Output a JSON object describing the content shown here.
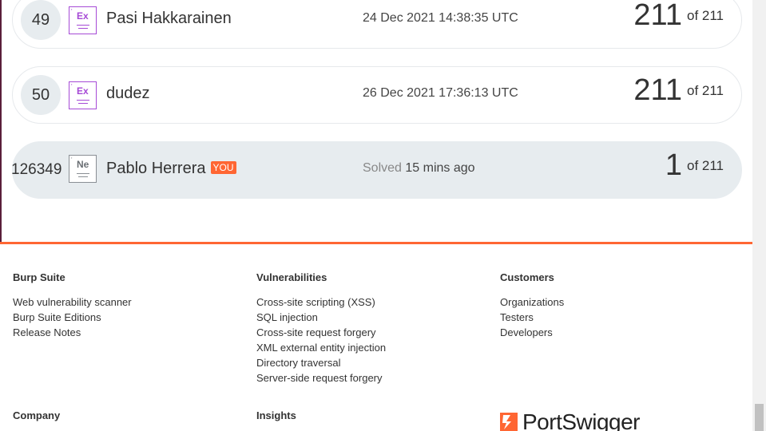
{
  "leaderboard": [
    {
      "rank": "49",
      "badge": "Ex",
      "name": "Pasi Hakkarainen",
      "date": "24 Dec 2021 14:38:35 UTC",
      "score": "211",
      "of": "of 211"
    },
    {
      "rank": "50",
      "badge": "Ex",
      "name": "dudez",
      "date": "26 Dec 2021 17:36:13 UTC",
      "score": "211",
      "of": "of 211"
    }
  ],
  "current_user": {
    "rank": "126349",
    "badge": "Ne",
    "name": "Pablo Herrera",
    "you_tag": "YOU",
    "solved_prefix": "Solved",
    "solved_time": "15 mins ago",
    "score": "1",
    "of": "of 211"
  },
  "footer": {
    "col1": {
      "heading": "Burp Suite",
      "links": [
        "Web vulnerability scanner",
        "Burp Suite Editions",
        "Release Notes"
      ]
    },
    "col2": {
      "heading": "Vulnerabilities",
      "links": [
        "Cross-site scripting (XSS)",
        "SQL injection",
        "Cross-site request forgery",
        "XML external entity injection",
        "Directory traversal",
        "Server-side request forgery"
      ]
    },
    "col3": {
      "heading": "Customers",
      "links": [
        "Organizations",
        "Testers",
        "Developers"
      ]
    },
    "company_heading": "Company",
    "insights_heading": "Insights",
    "logo_text": "PortSwigger"
  },
  "colors": {
    "accent": "#ff6633",
    "expert_badge": "#a64ad6",
    "row_highlight": "#e7ecef"
  }
}
